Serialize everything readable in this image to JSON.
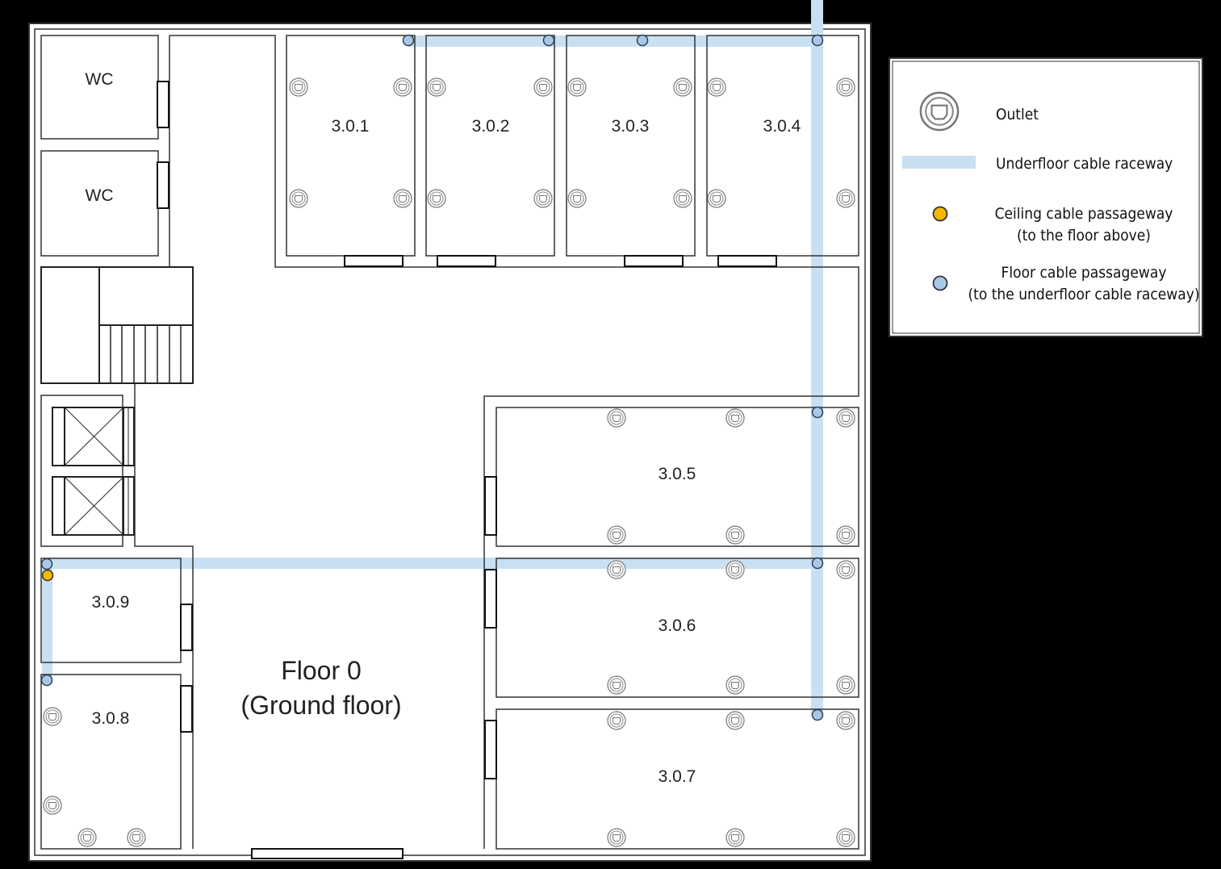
{
  "plan": {
    "title_line1": "Floor 0",
    "title_line2": "(Ground floor)",
    "wc_labels": [
      "WC",
      "WC"
    ],
    "room_labels": {
      "r301": "3.0.1",
      "r302": "3.0.2",
      "r303": "3.0.3",
      "r304": "3.0.4",
      "r305": "3.0.5",
      "r306": "3.0.6",
      "r307": "3.0.7",
      "r308": "3.0.8",
      "r309": "3.0.9"
    }
  },
  "legend": {
    "outlet": "Outlet",
    "raceway": "Underfloor cable raceway",
    "ceiling_line1": "Ceiling cable passageway",
    "ceiling_line2": "(to the floor above)",
    "floor_line1": "Floor cable passageway",
    "floor_line2": "(to the underfloor cable raceway)"
  },
  "colors": {
    "background": "#000000",
    "walls": "#333333",
    "floor": "#ffffff",
    "raceway": "#c9dff2",
    "floor_passage": "#a9c8e8",
    "ceiling_passage": "#f5b800"
  }
}
